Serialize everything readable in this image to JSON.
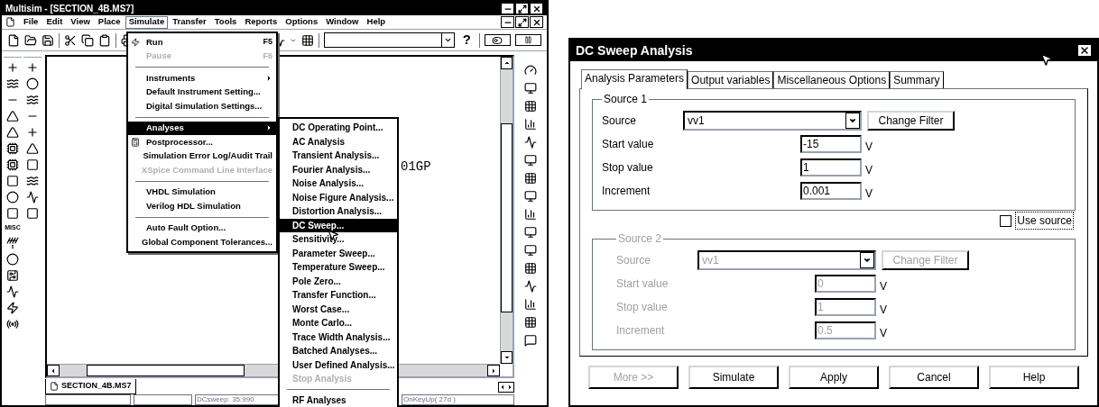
{
  "main_window": {
    "title": "Multisim - [SECTION_4B.MS7]",
    "menu": [
      {
        "label": "File",
        "open": false
      },
      {
        "label": "Edit",
        "open": false
      },
      {
        "label": "View",
        "open": false
      },
      {
        "label": "Place",
        "open": false
      },
      {
        "label": "Simulate",
        "open": true
      },
      {
        "label": "Transfer",
        "open": false
      },
      {
        "label": "Tools",
        "open": false
      },
      {
        "label": "Reports",
        "open": false
      },
      {
        "label": "Options",
        "open": false
      },
      {
        "label": "Window",
        "open": false
      },
      {
        "label": "Help",
        "open": false
      }
    ],
    "help_button": "?",
    "palette_label": "MISC",
    "canvas_text": "01GP",
    "document_tab": "SECTION_4B.MS7",
    "status_bar": [
      {
        "text": "DCsweep: 35.990"
      },
      {
        "text": "OnKeyUp( 27d )"
      }
    ]
  },
  "simulate_menu": [
    {
      "kind": "item",
      "label": "Run",
      "shortcut": "F5",
      "disabled": false,
      "submenu": false,
      "highlighted": false
    },
    {
      "kind": "item",
      "label": "Pause",
      "shortcut": "F6",
      "disabled": true,
      "submenu": false,
      "highlighted": false
    },
    {
      "kind": "separator"
    },
    {
      "kind": "item",
      "label": "Instruments",
      "disabled": false,
      "submenu": true,
      "highlighted": false
    },
    {
      "kind": "item",
      "label": "Default Instrument Setting...",
      "disabled": false,
      "submenu": false,
      "highlighted": false
    },
    {
      "kind": "item",
      "label": "Digital Simulation Settings...",
      "disabled": false,
      "submenu": false,
      "highlighted": false
    },
    {
      "kind": "separator"
    },
    {
      "kind": "item",
      "label": "Analyses",
      "disabled": false,
      "submenu": true,
      "highlighted": true
    },
    {
      "kind": "item",
      "label": "Postprocessor...",
      "disabled": false,
      "submenu": false,
      "highlighted": false
    },
    {
      "kind": "item",
      "label": "Simulation Error Log/Audit Trail",
      "disabled": false,
      "submenu": false,
      "highlighted": false
    },
    {
      "kind": "item",
      "label": "XSpice Command Line Interface",
      "disabled": true,
      "submenu": false,
      "highlighted": false
    },
    {
      "kind": "separator"
    },
    {
      "kind": "item",
      "label": "VHDL Simulation",
      "disabled": false,
      "submenu": false,
      "highlighted": false
    },
    {
      "kind": "item",
      "label": "Verilog HDL Simulation",
      "disabled": false,
      "submenu": false,
      "highlighted": false
    },
    {
      "kind": "separator"
    },
    {
      "kind": "item",
      "label": "Auto Fault Option...",
      "disabled": false,
      "submenu": false,
      "highlighted": false
    },
    {
      "kind": "item",
      "label": "Global Component Tolerances...",
      "disabled": false,
      "submenu": false,
      "highlighted": false
    }
  ],
  "analyses_menu": [
    {
      "kind": "item",
      "label": "DC Operating Point...",
      "disabled": false,
      "highlighted": false
    },
    {
      "kind": "item",
      "label": "AC Analysis",
      "disabled": false,
      "highlighted": false
    },
    {
      "kind": "item",
      "label": "Transient Analysis...",
      "disabled": false,
      "highlighted": false
    },
    {
      "kind": "item",
      "label": "Fourier Analysis...",
      "disabled": false,
      "highlighted": false
    },
    {
      "kind": "item",
      "label": "Noise Analysis...",
      "disabled": false,
      "highlighted": false
    },
    {
      "kind": "item",
      "label": "Noise Figure Analysis...",
      "disabled": false,
      "highlighted": false
    },
    {
      "kind": "item",
      "label": "Distortion Analysis...",
      "disabled": false,
      "highlighted": false
    },
    {
      "kind": "item",
      "label": "DC Sweep...",
      "disabled": false,
      "highlighted": true
    },
    {
      "kind": "item",
      "label": "Sensitivity...",
      "disabled": false,
      "highlighted": false
    },
    {
      "kind": "item",
      "label": "Parameter Sweep...",
      "disabled": false,
      "highlighted": false
    },
    {
      "kind": "item",
      "label": "Temperature Sweep...",
      "disabled": false,
      "highlighted": false
    },
    {
      "kind": "item",
      "label": "Pole Zero...",
      "disabled": false,
      "highlighted": false
    },
    {
      "kind": "item",
      "label": "Transfer Function...",
      "disabled": false,
      "highlighted": false
    },
    {
      "kind": "item",
      "label": "Worst Case...",
      "disabled": false,
      "highlighted": false
    },
    {
      "kind": "item",
      "label": "Monte Carlo...",
      "disabled": false,
      "highlighted": false
    },
    {
      "kind": "item",
      "label": "Trace Width Analysis...",
      "disabled": false,
      "highlighted": false
    },
    {
      "kind": "item",
      "label": "Batched Analyses...",
      "disabled": false,
      "highlighted": false
    },
    {
      "kind": "item",
      "label": "User Defined Analysis...",
      "disabled": false,
      "highlighted": false
    },
    {
      "kind": "item",
      "label": "Stop Analysis",
      "disabled": true,
      "highlighted": false
    },
    {
      "kind": "separator"
    },
    {
      "kind": "item",
      "label": "RF Analyses",
      "disabled": false,
      "highlighted": false
    }
  ],
  "dialog": {
    "title": "DC Sweep Analysis",
    "tabs": [
      {
        "label": "Analysis Parameters",
        "selected": true
      },
      {
        "label": "Output variables",
        "selected": false
      },
      {
        "label": "Miscellaneous Options",
        "selected": false
      },
      {
        "label": "Summary",
        "selected": false
      }
    ],
    "source1": {
      "legend": "Source 1",
      "disabled": false,
      "source_label": "Source",
      "source_value": "vv1",
      "filter_button": "Change Filter",
      "fields": [
        {
          "label": "Start value",
          "value": "-15",
          "unit": "V"
        },
        {
          "label": "Stop value",
          "value": "1",
          "unit": "V"
        },
        {
          "label": "Increment",
          "value": "0.001",
          "unit": "V"
        }
      ]
    },
    "use_source": {
      "label": "Use source",
      "checked": false
    },
    "source2": {
      "legend": "Source 2",
      "disabled": true,
      "source_label": "Source",
      "source_value": "vv1",
      "filter_button": "Change Filter",
      "fields": [
        {
          "label": "Start value",
          "value": "0",
          "unit": "V"
        },
        {
          "label": "Stop value",
          "value": "1",
          "unit": "V"
        },
        {
          "label": "Increment",
          "value": "0.5",
          "unit": "V"
        }
      ]
    },
    "buttons": [
      {
        "label": "More >>",
        "disabled": true
      },
      {
        "label": "Simulate",
        "disabled": false
      },
      {
        "label": "Apply",
        "disabled": false
      },
      {
        "label": "Cancel",
        "disabled": false
      },
      {
        "label": "Help",
        "disabled": false
      }
    ]
  }
}
